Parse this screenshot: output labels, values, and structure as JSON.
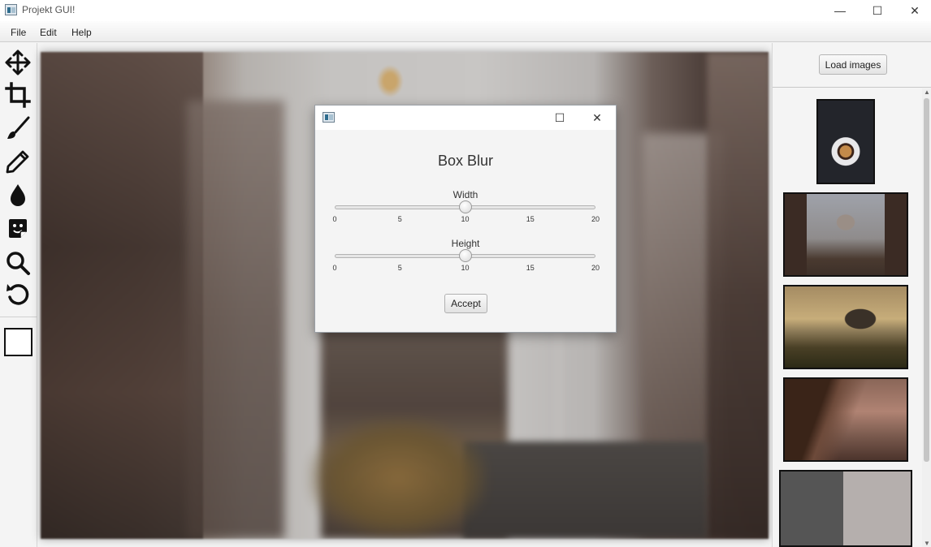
{
  "window": {
    "title": "Projekt GUI!",
    "minimize": "—",
    "maximize": "☐",
    "close": "✕"
  },
  "menu": {
    "file": "File",
    "edit": "Edit",
    "help": "Help"
  },
  "tools": [
    {
      "icon": "move-icon"
    },
    {
      "icon": "crop-icon"
    },
    {
      "icon": "brush-icon"
    },
    {
      "icon": "pencil-icon"
    },
    {
      "icon": "drop-icon"
    },
    {
      "icon": "sticker-icon"
    },
    {
      "icon": "zoom-icon"
    },
    {
      "icon": "undo-icon"
    }
  ],
  "color": {
    "current": "#ffffff"
  },
  "right_panel": {
    "load_label": "Load images",
    "thumbnails": [
      "coffee",
      "clock-tower",
      "beach-rock",
      "cliff",
      "gray-swatch"
    ]
  },
  "dialog": {
    "title": "Box Blur",
    "width_label": "Width",
    "height_label": "Height",
    "width_value": 10,
    "height_value": 10,
    "slider_min": 0,
    "slider_max": 20,
    "ticks": [
      "0",
      "5",
      "10",
      "15",
      "20"
    ],
    "accept_label": "Accept",
    "maximize": "☐",
    "close": "✕"
  }
}
